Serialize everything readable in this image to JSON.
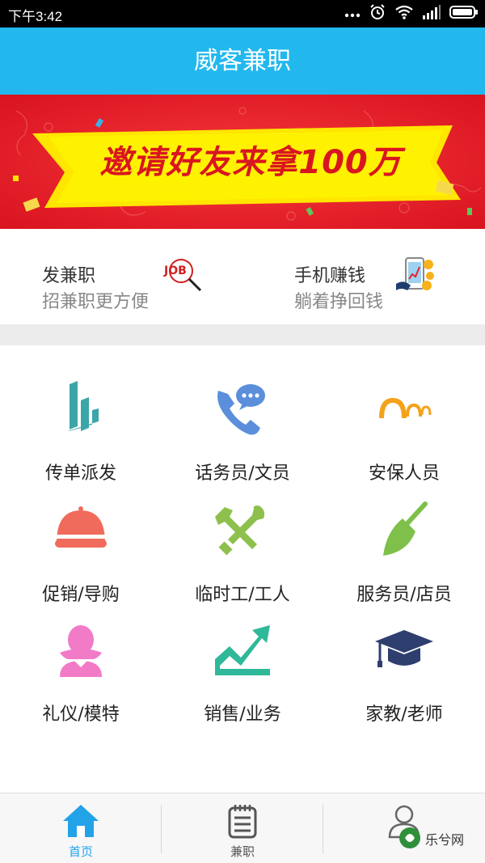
{
  "status_bar": {
    "time": "下午3:42"
  },
  "header": {
    "title": "威客兼职"
  },
  "banner": {
    "text": "邀请好友来拿100万",
    "colors": {
      "background": "#e8202c",
      "ribbon": "#ffe600",
      "text": "#d9161f"
    }
  },
  "promos": [
    {
      "title": "发兼职",
      "subtitle": "招兼职更方便",
      "icon": "job-magnifier-icon"
    },
    {
      "title": "手机赚钱",
      "subtitle": "躺着挣回钱",
      "icon": "phone-coins-icon"
    }
  ],
  "categories": [
    {
      "label": "传单派发",
      "icon": "leaflet-icon",
      "color": "#3ba6a8"
    },
    {
      "label": "话务员/文员",
      "icon": "phone-chat-icon",
      "color": "#5b8fdc"
    },
    {
      "label": "安保人员",
      "icon": "security-icon",
      "color": "#f5a21b"
    },
    {
      "label": "促销/导购",
      "icon": "cap-icon",
      "color": "#f06b5b"
    },
    {
      "label": "临时工/工人",
      "icon": "tools-icon",
      "color": "#8dc04c"
    },
    {
      "label": "服务员/店员",
      "icon": "broom-icon",
      "color": "#7ec04a"
    },
    {
      "label": "礼仪/模特",
      "icon": "lady-icon",
      "color": "#f27bc8"
    },
    {
      "label": "销售/业务",
      "icon": "chart-up-icon",
      "color": "#2fb89a"
    },
    {
      "label": "家教/老师",
      "icon": "graduation-cap-icon",
      "color": "#2e3e6e"
    }
  ],
  "bottom_nav": [
    {
      "label": "首页",
      "icon": "home-icon",
      "active": true,
      "color": "#22a3e8"
    },
    {
      "label": "兼职",
      "icon": "notebook-icon",
      "active": false,
      "color": "#555555"
    },
    {
      "label": "",
      "icon": "profile-icon",
      "active": false,
      "color": "#555555"
    }
  ],
  "watermark": {
    "text": "乐兮网"
  }
}
